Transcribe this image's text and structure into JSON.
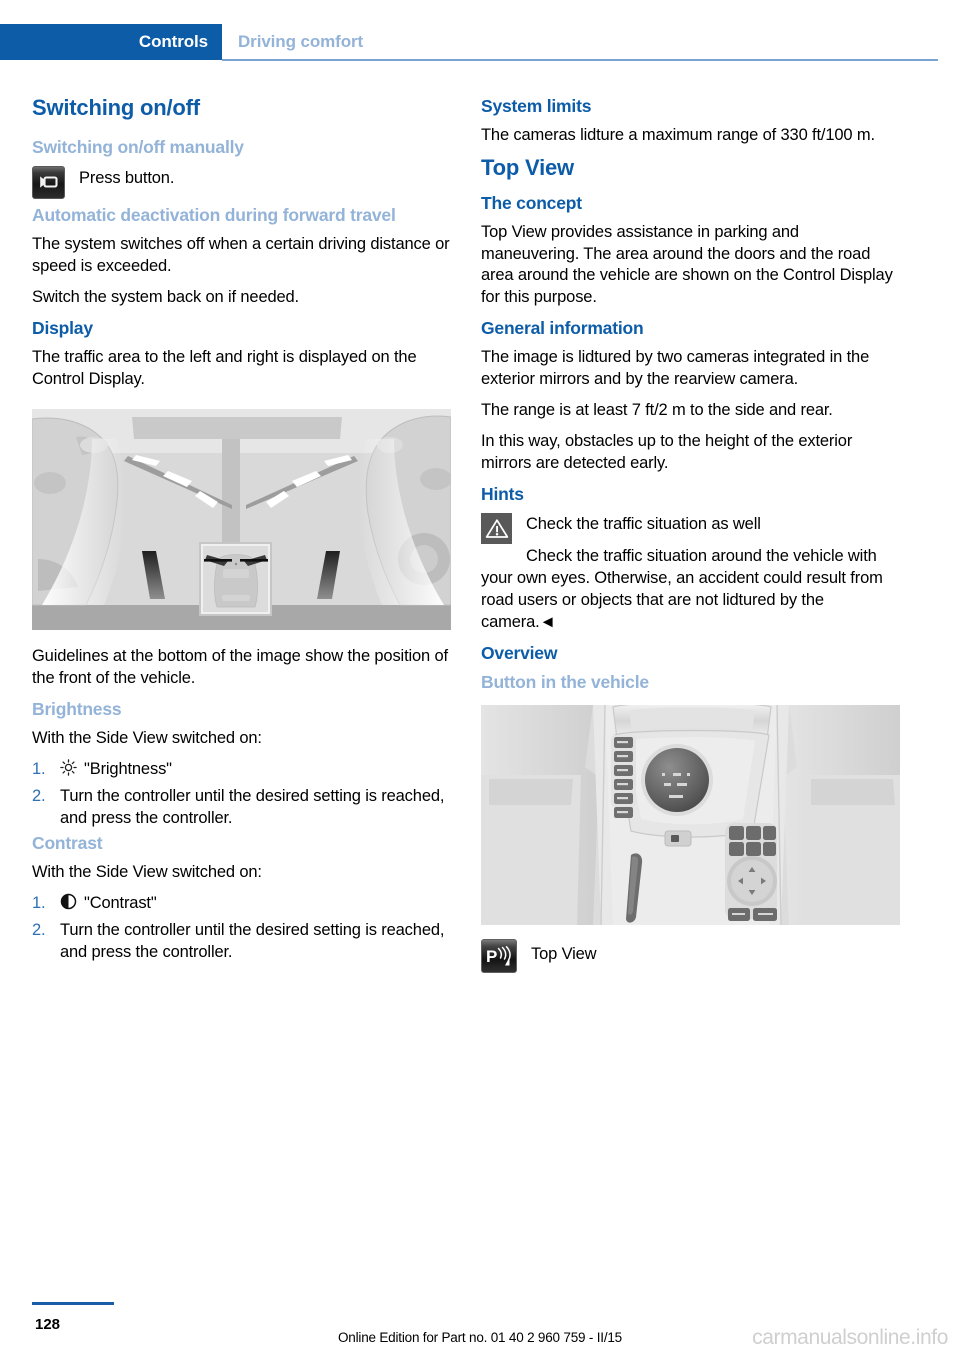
{
  "header": {
    "chapter": "Controls",
    "section": "Driving comfort"
  },
  "left_column": {
    "title": "Switching on/off",
    "sub_manual": "Switching on/off manually",
    "press_button": "Press button.",
    "camera_button_icon": "video-camera-button-icon",
    "auto_deactivation_heading": "Automatic deactivation during forward travel",
    "auto_p1": "The system switches off when a certain driving distance or speed is exceeded.",
    "auto_p2": "Switch the system back on if needed.",
    "display_heading": "Display",
    "display_p1": "The traffic area to the left and right is displayed on the Control Display.",
    "sideview_figure_name": "side-view-camera-display-illustration",
    "display_p2": "Guidelines at the bottom of the image show the position of the front of the vehicle.",
    "brightness_heading": "Brightness",
    "brightness_intro": "With the Side View switched on:",
    "brightness_steps": [
      {
        "num": "1.",
        "icon": "sun-icon",
        "text": "\"Brightness\""
      },
      {
        "num": "2.",
        "icon": "",
        "text": "Turn the controller until the desired setting is reached, and press the controller."
      }
    ],
    "contrast_heading": "Contrast",
    "contrast_intro": "With the Side View switched on:",
    "contrast_steps": [
      {
        "num": "1.",
        "icon": "contrast-icon",
        "text": "\"Contrast\""
      },
      {
        "num": "2.",
        "icon": "",
        "text": "Turn the controller until the desired setting is reached, and press the controller."
      }
    ]
  },
  "right_column": {
    "system_limits_heading": "System limits",
    "system_limits_p1": "The cameras lidture a maximum range of 330 ft/100 m.",
    "top_view_title": "Top View",
    "concept_heading": "The concept",
    "concept_p1": "Top View provides assistance in parking and maneuvering. The area around the doors and the road area around the vehicle are shown on the Control Display for this purpose.",
    "general_info_heading": "General information",
    "general_p1": "The image is lidtured by two cameras integrated in the exterior mirrors and by the rearview camera.",
    "general_p2": "The range is at least 7 ft/2 m to the side and rear.",
    "general_p3": "In this way, obstacles up to the height of the exterior mirrors are detected early.",
    "hints_heading": "Hints",
    "hint_icon": "warning-triangle-icon",
    "hint_title": "Check the traffic situation as well",
    "hint_body": "Check the traffic situation around the vehicle with your own eyes. Otherwise, an accident could result from road users or objects that are not lidtured by the camera.◄",
    "overview_heading": "Overview",
    "button_in_vehicle_heading": "Button in the vehicle",
    "console_figure_name": "center-console-photo",
    "pdc_icon": "pdc-top-view-icon",
    "pdc_caption": "Top View"
  },
  "footer": {
    "page_number": "128",
    "edition": "Online Edition for Part no. 01 40 2 960 759 - II/15",
    "watermark": "carmanualsonline.info"
  },
  "colors": {
    "brand_blue": "#0d5ca8",
    "light_blue": "#93b3d8",
    "rule_blue": "#7ba3d0",
    "step_number_blue": "#2f6fb5"
  }
}
